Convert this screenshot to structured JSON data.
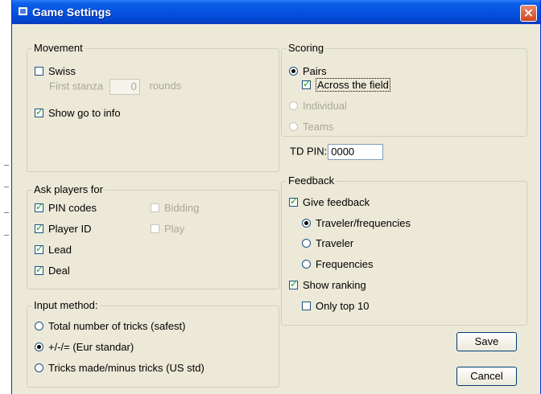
{
  "window": {
    "title": "Game Settings"
  },
  "movement": {
    "legend": "Movement",
    "swiss_label": "Swiss",
    "swiss_checked": false,
    "first_stanza_label": "First stanza",
    "first_stanza_value": "0",
    "rounds_label": "rounds",
    "show_goto_label": "Show go to info",
    "show_goto_checked": true
  },
  "ask_players": {
    "legend": "Ask players for",
    "items": [
      {
        "label": "PIN codes",
        "checked": true,
        "enabled": true
      },
      {
        "label": "Player ID",
        "checked": true,
        "enabled": true
      },
      {
        "label": "Lead",
        "checked": true,
        "enabled": true
      },
      {
        "label": "Deal",
        "checked": true,
        "enabled": true
      },
      {
        "label": "Bidding",
        "checked": false,
        "enabled": false
      },
      {
        "label": "Play",
        "checked": false,
        "enabled": false
      }
    ]
  },
  "input_method": {
    "legend": "Input method:",
    "options": [
      {
        "label": "Total number of tricks (safest)",
        "selected": false
      },
      {
        "label": "+/-/= (Eur standar)",
        "selected": true
      },
      {
        "label": "Tricks made/minus tricks (US std)",
        "selected": false
      }
    ]
  },
  "scoring": {
    "legend": "Scoring",
    "pairs_label": "Pairs",
    "across_label": "Across the field",
    "individual_label": "Individual",
    "teams_label": "Teams",
    "selected": "Pairs",
    "across_checked": true
  },
  "td_pin": {
    "label": "TD PIN:",
    "value": "0000"
  },
  "feedback": {
    "legend": "Feedback",
    "give_feedback_label": "Give feedback",
    "give_feedback_checked": true,
    "options": [
      {
        "label": "Traveler/frequencies",
        "selected": true
      },
      {
        "label": "Traveler",
        "selected": false
      },
      {
        "label": "Frequencies",
        "selected": false
      }
    ],
    "show_ranking_label": "Show ranking",
    "show_ranking_checked": true,
    "only_top_label": "Only top 10",
    "only_top_checked": false
  },
  "buttons": {
    "save": "Save",
    "cancel": "Cancel"
  }
}
